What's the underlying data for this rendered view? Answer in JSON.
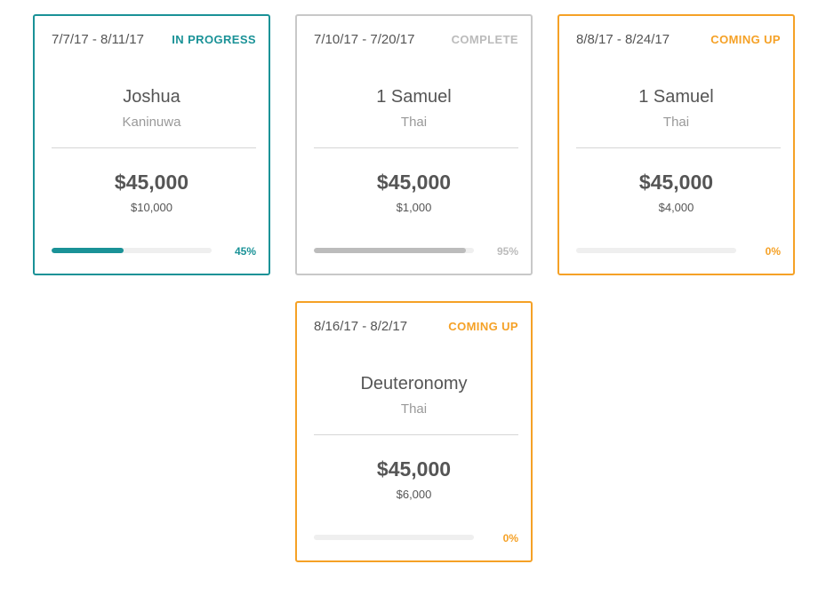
{
  "cards": [
    {
      "dates": "7/7/17 - 8/11/17",
      "status": "IN PROGRESS",
      "status_key": "progress",
      "book": "Joshua",
      "language": "Kaninuwa",
      "total": "$45,000",
      "raised": "$10,000",
      "progress_pct": 45,
      "progress_label": "45%"
    },
    {
      "dates": "7/10/17 - 7/20/17",
      "status": "COMPLETE",
      "status_key": "complete",
      "book": "1 Samuel",
      "language": "Thai",
      "total": "$45,000",
      "raised": "$1,000",
      "progress_pct": 95,
      "progress_label": "95%"
    },
    {
      "dates": "8/8/17 - 8/24/17",
      "status": "COMING UP",
      "status_key": "upcoming",
      "book": "1 Samuel",
      "language": "Thai",
      "total": "$45,000",
      "raised": "$4,000",
      "progress_pct": 0,
      "progress_label": "0%"
    },
    {
      "dates": "8/16/17 - 8/2/17",
      "status": "COMING UP",
      "status_key": "upcoming",
      "book": "Deuteronomy",
      "language": "Thai",
      "total": "$45,000",
      "raised": "$6,000",
      "progress_pct": 0,
      "progress_label": "0%"
    }
  ],
  "colors": {
    "in_progress": "#1a9297",
    "complete": "#bbbbbb",
    "coming_up": "#f5a126",
    "text": "#555555",
    "muted": "#999999"
  }
}
